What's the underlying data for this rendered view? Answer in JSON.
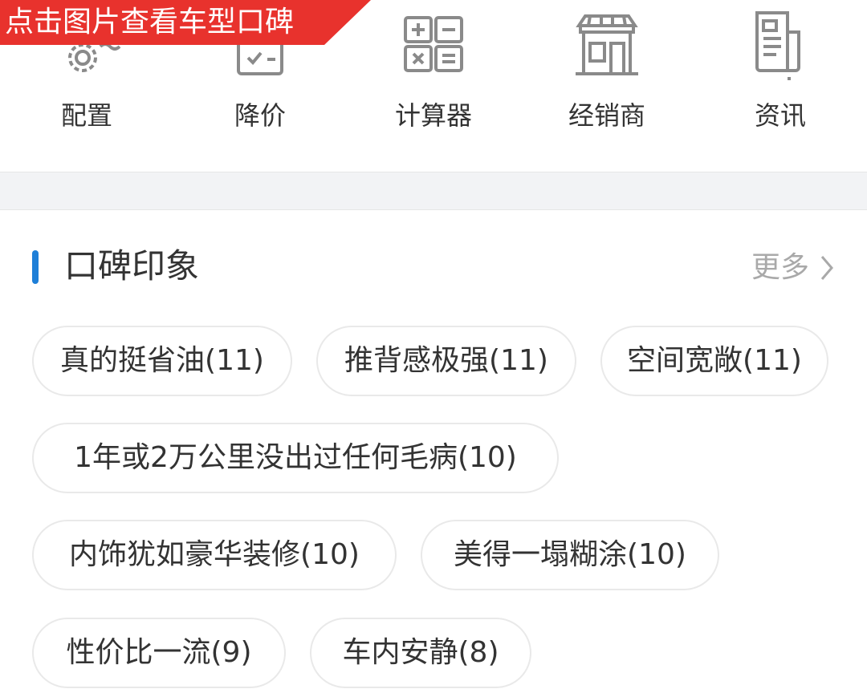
{
  "banner": {
    "text": "点击图片查看车型口碑",
    "color": "#e8322d"
  },
  "quick_nav": [
    {
      "label": "配置",
      "icon": "gear-icon"
    },
    {
      "label": "降价",
      "icon": "price-tag-icon"
    },
    {
      "label": "计算器",
      "icon": "calculator-icon"
    },
    {
      "label": "经销商",
      "icon": "storefront-icon"
    },
    {
      "label": "资讯",
      "icon": "news-icon"
    }
  ],
  "section": {
    "title": "口碑印象",
    "more_label": "更多",
    "accent_color": "#1e7fd8"
  },
  "tags": [
    "真的挺省油(11)",
    "推背感极强(11)",
    "空间宽敞(11)",
    "1年或2万公里没出过任何毛病(10)",
    "内饰犹如豪华装修(10)",
    "美得一塌糊涂(10)",
    "性价比一流(9)",
    "车内安静(8)"
  ]
}
